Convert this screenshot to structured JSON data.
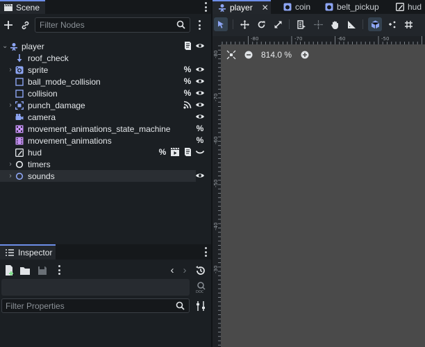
{
  "scene_dock": {
    "tab_label": "Scene",
    "filter_placeholder": "Filter Nodes"
  },
  "tree": [
    {
      "label": "player",
      "depth": 0,
      "expanded": true,
      "icon": "character-icon"
    },
    {
      "label": "roof_check",
      "depth": 1,
      "icon": "raycast-icon"
    },
    {
      "label": "sprite",
      "depth": 1,
      "collapsed": true,
      "icon": "animated-sprite-icon"
    },
    {
      "label": "ball_mode_collision",
      "depth": 1,
      "icon": "collision-shape-icon"
    },
    {
      "label": "collision",
      "depth": 1,
      "icon": "collision-shape-icon"
    },
    {
      "label": "punch_damage",
      "depth": 1,
      "collapsed": true,
      "icon": "area-icon"
    },
    {
      "label": "camera",
      "depth": 1,
      "icon": "camera-icon"
    },
    {
      "label": "movement_animations_state_machine",
      "depth": 1,
      "icon": "animation-tree-icon"
    },
    {
      "label": "movement_animations",
      "depth": 1,
      "icon": "animation-player-icon"
    },
    {
      "label": "hud",
      "depth": 1,
      "icon": "canvas-layer-icon"
    },
    {
      "label": "timers",
      "depth": 1,
      "collapsed": true,
      "icon": "node-icon"
    },
    {
      "label": "sounds",
      "depth": 1,
      "collapsed": true,
      "icon": "node-icon"
    }
  ],
  "unique_badge": "%",
  "inspector": {
    "tab_label": "Inspector",
    "filter_placeholder": "Filter Properties"
  },
  "editor_tabs": [
    {
      "label": "player",
      "active": true,
      "close": "✕"
    },
    {
      "label": "coin",
      "active": false
    },
    {
      "label": "belt_pickup",
      "active": false
    },
    {
      "label": "hud",
      "active": false
    }
  ],
  "viewport": {
    "zoom_label": "814.0 %",
    "ruler_top": [
      "-80",
      "-70",
      "-60",
      "-50"
    ],
    "ruler_left": [
      "-80",
      "-70",
      "-60",
      "-50",
      "-40",
      "-30"
    ]
  },
  "colors": {
    "accent": "#6d8ee8",
    "node_2d": "#8da5f3",
    "animation": "#c38ef1"
  }
}
